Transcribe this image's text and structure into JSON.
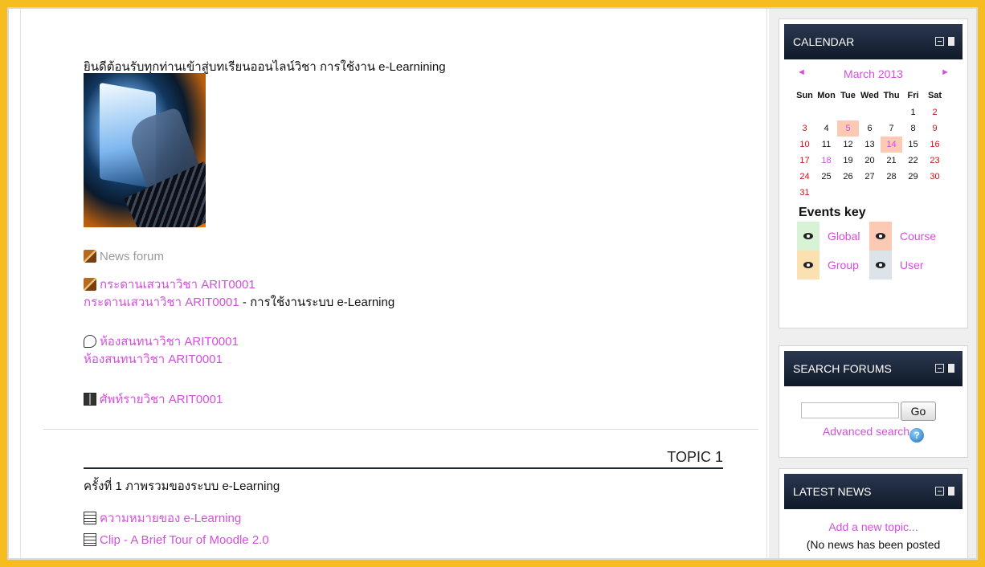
{
  "main": {
    "welcome_text": "ยินดีต้อนรับทุกท่านเข้าสู่บทเรียนออนไลน์วิชา การใช้งาน e-Learnining",
    "activities": [
      {
        "icon": "forum-icon",
        "label": "News forum"
      },
      {
        "icon": "forum-icon",
        "label": "กระดานเสวนาวิชา ARIT0001",
        "desc_link": "กระดานเสวนาวิชา ARIT0001",
        "desc_text": " - การใช้งานระบบ e-Learning"
      },
      {
        "icon": "chat-icon",
        "label": "ห้องสนทนาวิชา ARIT0001",
        "desc_link": "ห้องสนทนาวิชา ARIT0001"
      },
      {
        "icon": "glossary-icon",
        "label": "ศัพท์รายวิชา ARIT0001"
      }
    ],
    "topic": {
      "title": "TOPIC 1",
      "subtitle": "ครั้งที่ 1  ภาพรวมของระบบ e-Learning",
      "resources": [
        {
          "icon": "page-icon",
          "label": "ความหมายของ e-Learning"
        },
        {
          "icon": "page-icon",
          "label": "Clip - A Brief Tour of Moodle 2.0"
        }
      ]
    }
  },
  "calendar": {
    "header": "CALENDAR",
    "prev": "◄",
    "next": "►",
    "month": "March 2013",
    "weekdays": [
      "Sun",
      "Mon",
      "Tue",
      "Wed",
      "Thu",
      "Fri",
      "Sat"
    ],
    "weeks": [
      [
        "",
        "",
        "",
        "",
        "",
        "1",
        "2"
      ],
      [
        "3",
        "4",
        "5",
        "6",
        "7",
        "8",
        "9"
      ],
      [
        "10",
        "11",
        "12",
        "13",
        "14",
        "15",
        "16"
      ],
      [
        "17",
        "18",
        "19",
        "20",
        "21",
        "22",
        "23"
      ],
      [
        "24",
        "25",
        "26",
        "27",
        "28",
        "29",
        "30"
      ],
      [
        "31",
        "",
        "",
        "",
        "",
        "",
        ""
      ]
    ],
    "highlighted_days": [
      "5",
      "14"
    ],
    "link_days": [
      "18"
    ],
    "events_key_title": "Events key",
    "events_key": [
      {
        "label": "Global",
        "color": "#d7f2d4"
      },
      {
        "label": "Course",
        "color": "#fcc9b5"
      },
      {
        "label": "Group",
        "color": "#fbe1b0"
      },
      {
        "label": "User",
        "color": "#dce4e9"
      }
    ]
  },
  "search_forums": {
    "header": "SEARCH FORUMS",
    "go_label": "Go",
    "advanced_label": "Advanced search",
    "input_value": ""
  },
  "latest_news": {
    "header": "LATEST NEWS",
    "add_label": "Add a new topic...",
    "empty_label": "(No news has been posted"
  },
  "colors": {
    "frame": "#f5bd1f",
    "link": "#d34fdc",
    "block_header": "#1a2535"
  }
}
